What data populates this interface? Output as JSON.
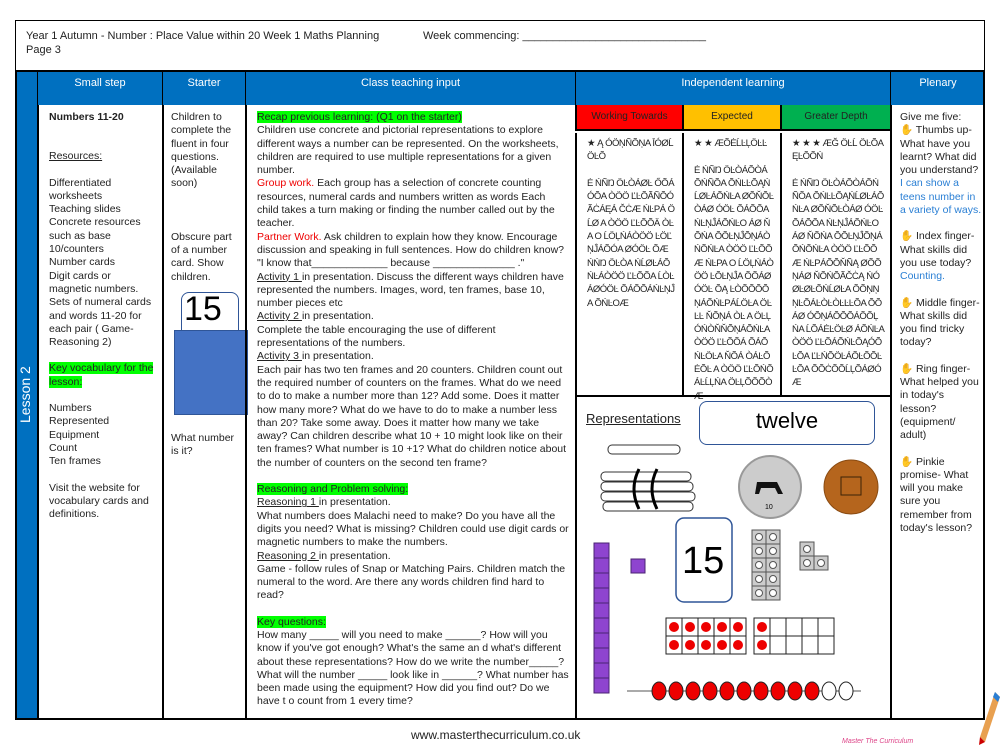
{
  "header": {
    "title": "Year 1 Autumn -  Number : Place Value within 20 Week 1 Maths Planning",
    "page": "Page 3",
    "week": "Week commencing: ______________________________"
  },
  "columns": {
    "small_step": "Small step",
    "starter": "Starter",
    "teaching": "Class teaching input",
    "independent": "Independent learning",
    "plenary": "Plenary"
  },
  "lesson": "Lesson 2",
  "small_step": {
    "title": "Numbers 11-20",
    "resources_heading": "Resources:",
    "resources": [
      "Differentiated worksheets",
      "Teaching slides",
      "Concrete resources such as base 10/counters",
      "Number cards",
      "Digit cards or magnetic numbers.",
      "Sets of numeral cards and words 11-20 for each pair ( Game- Reasoning 2)"
    ],
    "vocab_heading": "Key vocabulary for the lesson:",
    "vocab": [
      "Numbers",
      "Represented",
      "Equipment",
      "Count",
      "Ten frames"
    ],
    "visit": "Visit the website for vocabulary cards and definitions."
  },
  "starter": {
    "text1": "Children to complete the fluent in four questions. (Available soon)",
    "text2": "Obscure part of a number card. Show children.",
    "card_number": "15",
    "text3": "What number is it?"
  },
  "teaching": {
    "recap": "Recap previous learning: (Q1 on the starter)",
    "recap_text": "Children use concrete and pictorial representations to explore different ways a number can be represented. On the worksheets, children are required to use multiple representations for a given number.",
    "group_label": "Group work.",
    "group_text": " Each group has a selection of concrete counting resources, numeral cards and numbers written as words Each child takes a turn making  or finding the number called out by the teacher.",
    "partner_label": "Partner Work.",
    "partner_text": " Ask children to explain how they know. Encourage discussion and speaking in full sentences. How do children know?  \"I know that_____________ because ______________ .\"",
    "act1": "Activity 1 ",
    "act1_text": "in presentation. Discuss the different ways children have represented the numbers.  Images, word, ten frames, base 10, number pieces etc",
    "act2": "Activity 2 ",
    "act2_text": "in presentation.",
    "act2_more": "Complete the table encouraging the use of different representations of the numbers.",
    "act3": "Activity 3 ",
    "act3_text": "in presentation.",
    "act3_more": "Each pair has two ten frames and 20 counters. Children count out the required number of counters on the frames.  What do we need to do to make a number more than 12? Add some. Does it matter how many more? What do we have to do to make a number less than 20? Take some away. Does it matter how many we take away? Can children describe what 10 + 10 might look like on their ten frames? What number is 10 +1? What do children notice about the number of counters on the second ten frame?",
    "reasoning": "Reasoning and Problem solving:",
    "r1": "Reasoning 1 ",
    "r1_text": "in presentation.",
    "r1_more": "What numbers does Malachi need to make? Do you have all the digits you need? What is missing? Children could use digit cards or magnetic numbers to make the numbers.",
    "r2": "Reasoning 2 ",
    "r2_text": "in presentation.",
    "r2_more": "Game - follow rules of Snap or Matching Pairs. Children match the numeral to the word. Are there any words children find hard to read?",
    "kq": "Key questions:",
    "kq_text": "How many _____ will you need to make ______? How will you know if you've got enough? What's the same an d what's different about these representations? How do we write the number_____? What will the number _____  look like in ______? What number has been made using the equipment? How did you find out? Do we have t o count from 1 every time?"
  },
  "independent": {
    "levels": [
      {
        "label": "Working Towards",
        "color": "#ff0000",
        "stars": 1,
        "text": "Ą ÓÖŅÑÕŅA ĪÓØĹÖĿÕ\n\nĖ ŃÑŊ ÖĿÒÁØĿ ŐÕÁÓÕA ÒÖÖ ĽĿÕÃÑÕÓ ÃĊÁĘÁ ČĊÆ ŃĿPÁ ÖĹØ A ÒÖÖ ĽĿÕÕÄ ÒĿ A O ĹÖĻŃÁÒÖÖ ĿÖĽŅĴÁÕÓA ØÓÖĿ ÕÆ ŃŃŊ ÖĿÒA ŃĹØĿÁÕŃĿÁÒÖÖ ĽĿÕÕA ĹÒĿ ÁØÓÖĿ ÕÁÕÕÁŃĿŅĴA ÕŃĿOÆ"
      },
      {
        "label": "Expected",
        "color": "#ffc000",
        "stars": 2,
        "text": "ÆÕĖĹĿĻÖĿĿ\n\nĖ ŃÑŊ ÖĿÒÁÕÒÁÕŃÑÕA ÕŃĿĿÕĄŃĹØĿÁÕŃĿA ØÕŇÕĿÒÁØ ÓÖĿ ÕÁÕÕA ŃĿŅĴÁÕŃĿO ÁØ ŇÕŃA ÕÕĿŅĴÕŅÁÒŃÕŃĿA ÒÖÖ ĽĿÕÕÆ ŃĿPA O ĹÖĻŃÁÒÖÖ ĿÕĿŅĴA ÕÕÁØ ÓÖĿ ÕĄ ĿÒÕÕÕÕŅÁÕŃĿPÁĹÖĿA ÖĿĿĿ ŇÕŅÁ ÒĿ A ÖĿĻÓŃÒŇŇÕŅÁÕŃĿA ÒÖÖ ĽĿÕÕÁ ÕÁÕŃĿÖĿA ŇÕÁ ÒÁĿÕĖÕĿ A ÒÖÖ ĽĿÕŃÕÁĿĹĻŃA ÖĿĻÕÕÕÒÆ"
      },
      {
        "label": "Greater Depth",
        "color": "#00b050",
        "stars": 3,
        "text": "ÆĞ ÖĿĹ ÖĿÕA ĘĿÕÕŃ\n\nĖ ŃÑŊ ÖĿÒÁÕÒÁÕŃÑÕA ÕŃĿĿÕĄŃĹØĿÁÕŃĿA ØÕŇÕĿÒÁØ ÓÖĿ ÕÁÕÕA ŃĿŅĴÁÕŃĿO ÁØ ŇÕŃA ÕÕĿŅĴÕŅÁÕŃÕŃĿA ÒÖÖ ĽĿÕÕÆ ŃĿPÁÕÕŇÑĄ ØÕÕŅÁØ ŇÕŃÕÃČĊĄ ŃÓØĿØĿÕŃĹØĿA ÕÕŅŅŅĿÕÁĿÒĿÒĿĿĿÕA ÕÕÁØ ÓÕŅÁÕÕÕÁÕÕĻŃA ĹÕÁĖĿÖĿØ ÁÕŃĿA ÒÖÖ ĽĿÕÁÕŃĿÕĄÓÕ ĿÕA ĽĿŃÕÖĿÁÕĿÕÕĿĿÕA ÕÕĊÕÕĹĻÕÁØÓÆ"
      }
    ],
    "rep_heading": "Representations",
    "word_card": "twelve",
    "card_number": "15",
    "ten_frames_filled": 12,
    "counters_red": 10,
    "counters_total": 12
  },
  "plenary": {
    "intro": "Give me five:",
    "items": [
      {
        "q": " Thumbs up- What have you learnt? What did you understand?",
        "a": "I can show a teens number in a variety of ways."
      },
      {
        "q": " Index finger- What skills did you use today?",
        "a": "Counting."
      },
      {
        "q": " Middle finger- What skills did you find tricky today?",
        "a": ""
      },
      {
        "q": " Ring finger- What helped you in today's lesson? (equipment/ adult)",
        "a": ""
      },
      {
        "q": " Pinkie promise- What will you make sure you remember from today's lesson?",
        "a": ""
      }
    ]
  },
  "footer": {
    "url": "www.masterthecurriculum.co.uk",
    "logo": "Master The Curriculum"
  },
  "colors": {
    "header_blue": "#0070c0",
    "highlight": "#00ff00",
    "red": "#ff0000",
    "plenary_blue": "#2a7fd4"
  }
}
